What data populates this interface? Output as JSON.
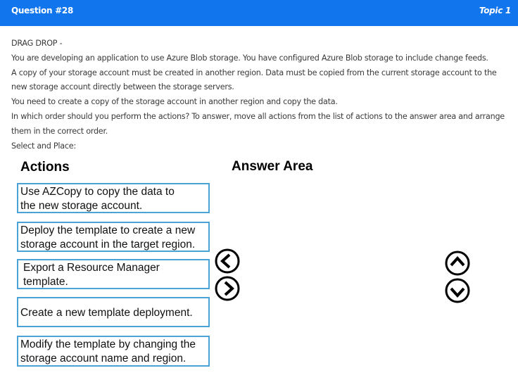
{
  "header": {
    "question": "Question #28",
    "topic": "Topic 1"
  },
  "question_text": {
    "lines": [
      "DRAG DROP -",
      "You are developing an application to use Azure Blob storage. You have configured Azure Blob storage to include change feeds.",
      "A copy of your storage account must be created in another region. Data must be copied from the current storage account to the new storage account directly between the storage servers.",
      "You need to create a copy of the storage account in another region and copy the data.",
      "In which order should you perform the actions? To answer, move all actions from the list of actions to the answer area and arrange them in the correct order.",
      "Select and Place:"
    ]
  },
  "actions_heading": "Actions",
  "answer_heading": "Answer Area",
  "actions": [
    {
      "line1": "Use AZCopy to copy the data to",
      "line2": "the new storage account."
    },
    {
      "line1": "Deploy the template to create a new",
      "line2": "storage account in the target region."
    },
    {
      "line1": "Export a Resource Manager",
      "line2": "template."
    },
    {
      "line1": "Create a new template deployment.",
      "line2": ""
    },
    {
      "line1": "Modify the template by changing the",
      "line2": "storage account name and region."
    }
  ],
  "controls": {
    "left_icon": "arrow-left-circle-icon",
    "right_icon": "arrow-right-circle-icon",
    "up_icon": "arrow-up-circle-icon",
    "down_icon": "arrow-down-circle-icon"
  },
  "colors": {
    "header_bg": "#1175ee",
    "box_border": "#4aa3d4"
  }
}
